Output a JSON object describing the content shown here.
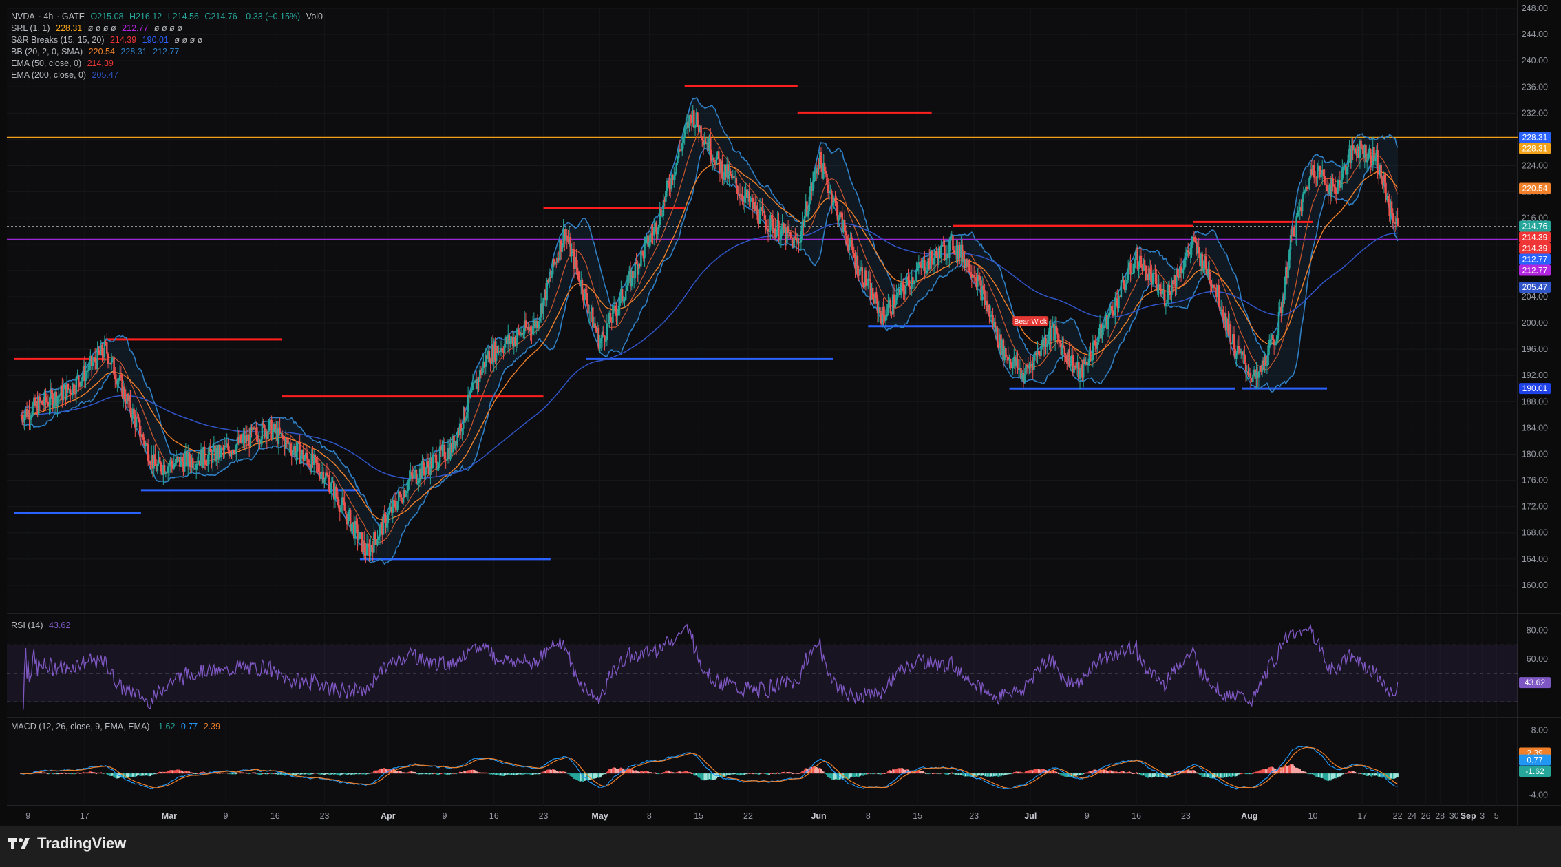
{
  "header": {
    "symbol": "NVDA",
    "interval": "4h",
    "exchange": "GATE",
    "open": "O215.08",
    "high": "H216.12",
    "low": "L214.56",
    "close": "C214.76",
    "change": "-0.33 (−0.15%)",
    "volume": "Vol0"
  },
  "indicators": {
    "srl": {
      "label": "SRL (1, 1)",
      "v1": "228.31",
      "rest": "ø ø ø ø",
      "v2": "212.77",
      "rest2": "ø ø ø ø"
    },
    "snr": {
      "label": "S&R Breaks (15, 15, 20)",
      "v1": "214.39",
      "v2": "190.01",
      "rest": "ø ø ø ø"
    },
    "bb": {
      "label": "BB (20, 2, 0, SMA)",
      "v1": "220.54",
      "v2": "228.31",
      "v3": "212.77"
    },
    "ema50": {
      "label": "EMA (50, close, 0)",
      "v": "214.39"
    },
    "ema200": {
      "label": "EMA (200, close, 0)",
      "v": "205.47"
    },
    "rsi": {
      "label": "RSI (14)",
      "v": "43.62"
    },
    "macd": {
      "label": "MACD (12, 26, close, 9, EMA, EMA)",
      "v1": "-1.62",
      "v2": "0.77",
      "v3": "2.39"
    }
  },
  "colors": {
    "background": "#0b0b0c",
    "up": "#26a69a",
    "down": "#ef5350",
    "resistance": "#ff1f1f",
    "support": "#2962ff",
    "bollinger": "#2f7fc4",
    "ema_orange": "#f0802a",
    "ema_blue": "#2f55c9",
    "horizontal_orange": "#f2a218",
    "horizontal_purple": "#9b27d4",
    "rsi_line": "#7e57c2"
  },
  "annotations": {
    "bear_wick": "Bear Wick"
  },
  "branding": {
    "name": "TradingView"
  },
  "chart_data": {
    "type": "candlestick",
    "price_axis": {
      "range": [
        156,
        248
      ],
      "ticks": [
        "248.00",
        "244.00",
        "240.00",
        "236.00",
        "232.00",
        "228.00",
        "224.00",
        "220.00",
        "216.00",
        "212.00",
        "208.00",
        "204.00",
        "200.00",
        "196.00",
        "192.00",
        "188.00",
        "184.00",
        "180.00",
        "176.00",
        "172.00",
        "168.00",
        "164.00",
        "160.00"
      ]
    },
    "price_labels": [
      {
        "value": 228.31,
        "text": "228.31",
        "color": "#2962ff"
      },
      {
        "value": 228.31,
        "text": "228.31",
        "color": "#f2a218"
      },
      {
        "value": 220.54,
        "text": "220.54",
        "color": "#f0802a"
      },
      {
        "value": 214.76,
        "text": "214.76",
        "color": "#26a69a"
      },
      {
        "value": 214.39,
        "text": "214.39",
        "color": "#ef3535"
      },
      {
        "value": 214.39,
        "text": "214.39",
        "color": "#ef3535"
      },
      {
        "value": 212.77,
        "text": "212.77",
        "color": "#2962ff"
      },
      {
        "value": 212.77,
        "text": "212.77",
        "color": "#b326e0"
      },
      {
        "value": 205.47,
        "text": "205.47",
        "color": "#2f55c9"
      },
      {
        "value": 190.01,
        "text": "190.01",
        "color": "#1f43e8"
      }
    ],
    "horizontal_lines": [
      {
        "value": 228.31,
        "color": "#f2a218"
      },
      {
        "value": 212.77,
        "color": "#9b27d4"
      },
      {
        "value": 214.76,
        "color": "#8a8f98",
        "dashed": true
      }
    ],
    "resistance_segments": [
      {
        "from": "2025-02-07",
        "to": "2025-02-20",
        "value": 194.5
      },
      {
        "from": "2025-02-20",
        "to": "2025-03-17",
        "value": 197.5
      },
      {
        "from": "2025-03-17",
        "to": "2025-04-23",
        "value": 188.8
      },
      {
        "from": "2025-04-23",
        "to": "2025-05-13",
        "value": 217.6
      },
      {
        "from": "2025-05-13",
        "to": "2025-05-29",
        "value": 236.1
      },
      {
        "from": "2025-05-29",
        "to": "2025-06-17",
        "value": 232.1
      },
      {
        "from": "2025-06-20",
        "to": "2025-07-24",
        "value": 214.8
      },
      {
        "from": "2025-07-24",
        "to": "2025-08-10",
        "value": 215.4
      }
    ],
    "support_segments": [
      {
        "from": "2025-02-07",
        "to": "2025-02-25",
        "value": 171.0
      },
      {
        "from": "2025-02-25",
        "to": "2025-03-28",
        "value": 174.5
      },
      {
        "from": "2025-03-28",
        "to": "2025-04-24",
        "value": 164.0
      },
      {
        "from": "2025-04-29",
        "to": "2025-06-03",
        "value": 194.5
      },
      {
        "from": "2025-06-08",
        "to": "2025-06-26",
        "value": 199.5
      },
      {
        "from": "2025-06-28",
        "to": "2025-07-30",
        "value": 190.0
      },
      {
        "from": "2025-07-31",
        "to": "2025-08-12",
        "value": 190.01
      }
    ],
    "x_axis": {
      "ticks": [
        {
          "date": "2025-02-09",
          "label": "9"
        },
        {
          "date": "2025-02-17",
          "label": "17"
        },
        {
          "date": "2025-03-01",
          "label": "Mar"
        },
        {
          "date": "2025-03-09",
          "label": "9"
        },
        {
          "date": "2025-03-16",
          "label": "16"
        },
        {
          "date": "2025-03-23",
          "label": "23"
        },
        {
          "date": "2025-04-01",
          "label": "Apr"
        },
        {
          "date": "2025-04-09",
          "label": "9"
        },
        {
          "date": "2025-04-16",
          "label": "16"
        },
        {
          "date": "2025-04-23",
          "label": "23"
        },
        {
          "date": "2025-05-01",
          "label": "May"
        },
        {
          "date": "2025-05-08",
          "label": "8"
        },
        {
          "date": "2025-05-15",
          "label": "15"
        },
        {
          "date": "2025-05-22",
          "label": "22"
        },
        {
          "date": "2025-06-01",
          "label": "Jun"
        },
        {
          "date": "2025-06-08",
          "label": "8"
        },
        {
          "date": "2025-06-15",
          "label": "15"
        },
        {
          "date": "2025-06-23",
          "label": "23"
        },
        {
          "date": "2025-07-01",
          "label": "Jul"
        },
        {
          "date": "2025-07-09",
          "label": "9"
        },
        {
          "date": "2025-07-16",
          "label": "16"
        },
        {
          "date": "2025-07-23",
          "label": "23"
        },
        {
          "date": "2025-08-01",
          "label": "Aug"
        },
        {
          "date": "2025-08-10",
          "label": "10"
        },
        {
          "date": "2025-08-17",
          "label": "17"
        },
        {
          "date": "2025-08-22",
          "label": "22"
        },
        {
          "date": "2025-08-24",
          "label": "24"
        },
        {
          "date": "2025-08-26",
          "label": "26"
        },
        {
          "date": "2025-08-28",
          "label": "28"
        },
        {
          "date": "2025-08-30",
          "label": "30"
        },
        {
          "date": "2025-09-01",
          "label": "Sep"
        },
        {
          "date": "2025-09-03",
          "label": "3"
        },
        {
          "date": "2025-09-05",
          "label": "5"
        }
      ]
    },
    "key_closes": [
      {
        "date": "2025-02-08",
        "close": 186.0
      },
      {
        "date": "2025-02-15",
        "close": 190.0
      },
      {
        "date": "2025-02-20",
        "close": 196.0
      },
      {
        "date": "2025-02-27",
        "close": 178.0
      },
      {
        "date": "2025-03-08",
        "close": 180.0
      },
      {
        "date": "2025-03-15",
        "close": 184.0
      },
      {
        "date": "2025-03-23",
        "close": 177.0
      },
      {
        "date": "2025-03-29",
        "close": 165.0
      },
      {
        "date": "2025-04-04",
        "close": 176.0
      },
      {
        "date": "2025-04-10",
        "close": 181.0
      },
      {
        "date": "2025-04-15",
        "close": 195.0
      },
      {
        "date": "2025-04-22",
        "close": 200.0
      },
      {
        "date": "2025-04-26",
        "close": 214.0
      },
      {
        "date": "2025-05-01",
        "close": 197.0
      },
      {
        "date": "2025-05-05",
        "close": 206.0
      },
      {
        "date": "2025-05-09",
        "close": 215.0
      },
      {
        "date": "2025-05-14",
        "close": 232.0
      },
      {
        "date": "2025-05-18",
        "close": 224.0
      },
      {
        "date": "2025-05-24",
        "close": 216.0
      },
      {
        "date": "2025-05-29",
        "close": 212.0
      },
      {
        "date": "2025-06-01",
        "close": 225.0
      },
      {
        "date": "2025-06-06",
        "close": 210.0
      },
      {
        "date": "2025-06-10",
        "close": 201.0
      },
      {
        "date": "2025-06-15",
        "close": 208.0
      },
      {
        "date": "2025-06-20",
        "close": 212.0
      },
      {
        "date": "2025-06-23",
        "close": 208.0
      },
      {
        "date": "2025-06-27",
        "close": 196.0
      },
      {
        "date": "2025-06-30",
        "close": 192.0
      },
      {
        "date": "2025-07-04",
        "close": 199.0
      },
      {
        "date": "2025-07-08",
        "close": 192.0
      },
      {
        "date": "2025-07-13",
        "close": 203.0
      },
      {
        "date": "2025-07-16",
        "close": 210.0
      },
      {
        "date": "2025-07-20",
        "close": 204.0
      },
      {
        "date": "2025-07-24",
        "close": 212.0
      },
      {
        "date": "2025-07-27",
        "close": 206.0
      },
      {
        "date": "2025-07-30",
        "close": 196.0
      },
      {
        "date": "2025-08-02",
        "close": 191.0
      },
      {
        "date": "2025-08-05",
        "close": 199.0
      },
      {
        "date": "2025-08-07",
        "close": 213.0
      },
      {
        "date": "2025-08-10",
        "close": 224.0
      },
      {
        "date": "2025-08-13",
        "close": 220.0
      },
      {
        "date": "2025-08-16",
        "close": 227.0
      },
      {
        "date": "2025-08-19",
        "close": 225.0
      },
      {
        "date": "2025-08-21",
        "close": 217.0
      },
      {
        "date": "2025-08-22",
        "close": 214.76
      }
    ],
    "rsi_panel": {
      "ticks": [
        "80.00",
        "60.00"
      ],
      "bands": [
        70,
        50,
        30
      ],
      "current": 43.62
    },
    "macd_panel": {
      "ticks": [
        "8.00",
        "-4.00"
      ],
      "values": {
        "macd": 0.77,
        "signal": 2.39,
        "histogram": -1.62
      }
    }
  }
}
